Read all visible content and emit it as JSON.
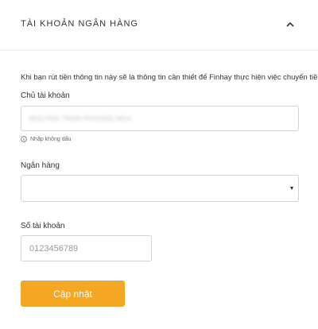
{
  "section": {
    "title": "TÀI KHOẢN NGÂN HÀNG",
    "collapse_icon": "chevron-up-icon"
  },
  "form": {
    "description": "Khi bạn rút tiền thông tin này sẽ là thông tin cần thiết để Finhay thực hiện việc chuyển tiền.",
    "account_holder": {
      "label": "Chủ tài khoản",
      "value": "NGUYEN TRAN PHUONG NGA",
      "hint": "Nhập không dấu",
      "hint_icon": "info-icon"
    },
    "bank": {
      "label": "Ngân hàng",
      "selected_value": "",
      "arrow_icon": "caret-down-icon"
    },
    "account_number": {
      "label": "Số tài khoản",
      "placeholder": "0123456789"
    },
    "update_button_label": "Cập nhật"
  },
  "colors": {
    "accent": "#f5a623",
    "border": "#d3d3d3",
    "text": "#333333",
    "placeholder": "#999999"
  }
}
